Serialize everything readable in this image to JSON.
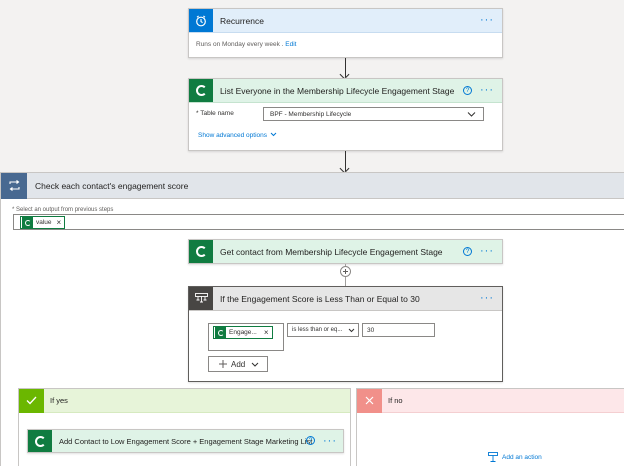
{
  "recurrence": {
    "title": "Recurrence",
    "summary": "Runs on Monday every week",
    "edit_link": "Edit",
    "accent": "#0078d4"
  },
  "list_step": {
    "title": "List Everyone in the Membership Lifecycle Engagement Stage",
    "field_label": "* Table name",
    "field_value": "BPF - Membership Lifecycle",
    "advanced_link": "Show advanced options",
    "advanced_icon": "chevron-down-icon"
  },
  "loop": {
    "title": "Check each contact's engagement score",
    "field_label": "* Select an output from previous steps",
    "token_label": "value",
    "token_remove": "×"
  },
  "get_step": {
    "title": "Get contact from Membership Lifecycle Engagement Stage"
  },
  "condition": {
    "title": "If the Engagement Score is Less Than or Equal to 30",
    "left_token": "Engage...",
    "left_remove": "×",
    "operator": "is less than or eq...",
    "right_value": "30",
    "add_button": "Add",
    "accent": "#484644"
  },
  "branches": {
    "yes_label": "If yes",
    "no_label": "If no",
    "yes_accent": "#6bb700",
    "no_accent": "#e8736c",
    "yes_action_title": "Add Contact to Low Engagement Score + Engagement Stage Marketing List",
    "add_action_link": "Add an action"
  },
  "common": {
    "more_glyph": "···",
    "help_glyph": "?",
    "dataverse_color": "#107c41"
  }
}
